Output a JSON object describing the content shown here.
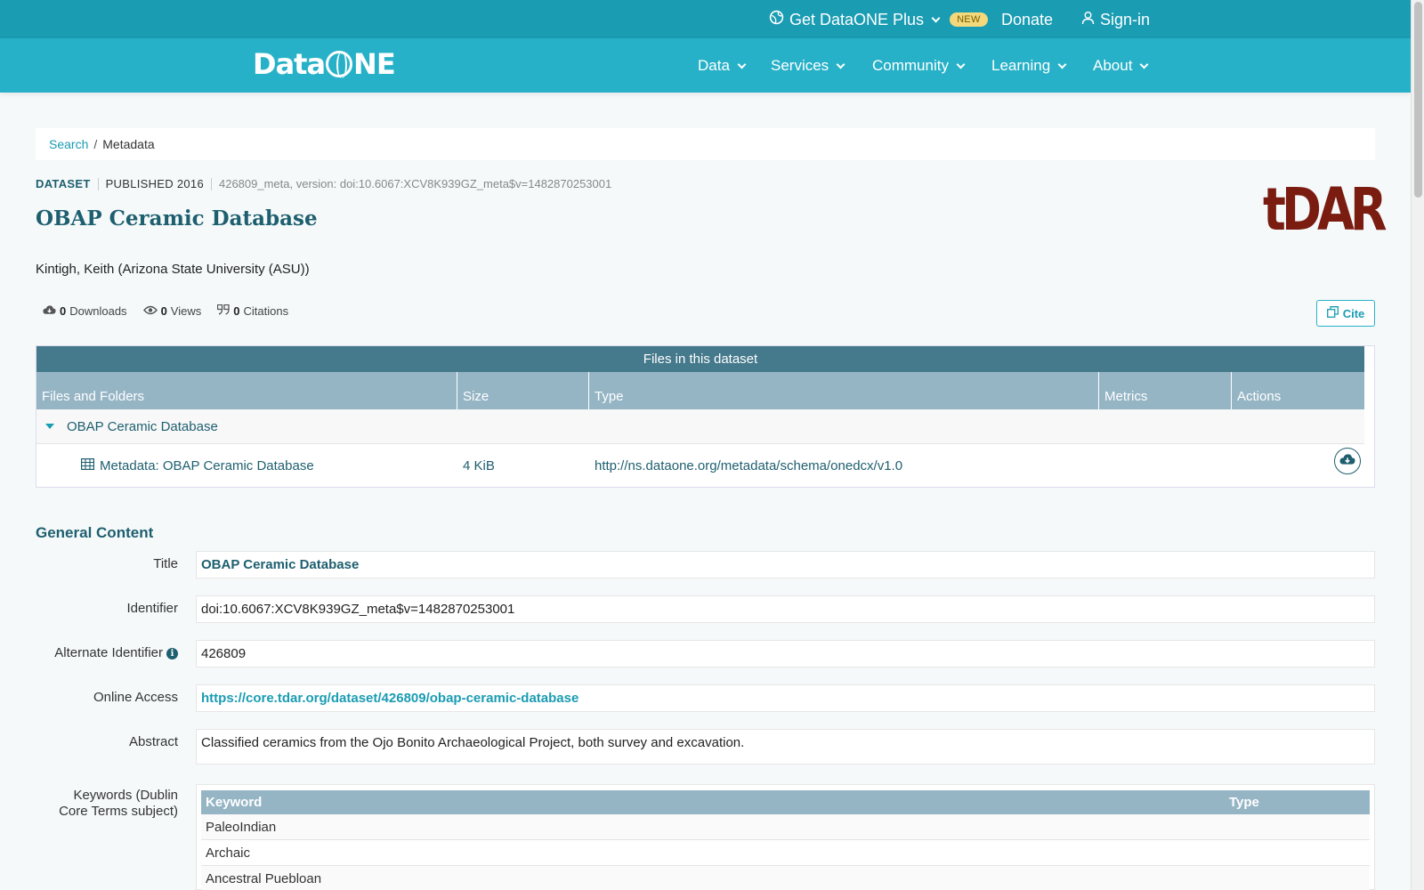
{
  "topbar": {
    "plus_label": "Get DataONE Plus",
    "new_badge": "NEW",
    "donate_label": "Donate",
    "signin_label": "Sign-in"
  },
  "logo": {
    "part1": "Data",
    "part2": "NE"
  },
  "nav": {
    "items": [
      {
        "label": "Data"
      },
      {
        "label": "Services"
      },
      {
        "label": "Community"
      },
      {
        "label": "Learning"
      },
      {
        "label": "About"
      }
    ]
  },
  "breadcrumb": {
    "search": "Search",
    "separator": "/",
    "current": "Metadata"
  },
  "dataset": {
    "type": "DATASET",
    "published": "PUBLISHED 2016",
    "version": "426809_meta, version: doi:10.6067:XCV8K939GZ_meta$v=1482870253001",
    "title": "OBAP Ceramic Database",
    "repo_logo": "tDAR",
    "author": "Kintigh, Keith (Arizona State University (ASU))"
  },
  "metrics": {
    "downloads_count": "0",
    "downloads_label": "Downloads",
    "views_count": "0",
    "views_label": "Views",
    "citations_count": "0",
    "citations_label": "Citations",
    "cite_label": "Cite"
  },
  "files": {
    "heading": "Files in this dataset",
    "columns": [
      "Files and Folders",
      "Size",
      "Type",
      "Metrics",
      "Actions"
    ],
    "folder": "OBAP Ceramic Database",
    "file": {
      "name": "Metadata: OBAP Ceramic Database",
      "size": "4 KiB",
      "type": "http://ns.dataone.org/metadata/schema/onedcx/v1.0"
    }
  },
  "general": {
    "heading": "General Content",
    "title_label": "Title",
    "title_value": "OBAP Ceramic Database",
    "identifier_label": "Identifier",
    "identifier_value": "doi:10.6067:XCV8K939GZ_meta$v=1482870253001",
    "alt_identifier_label": "Alternate Identifier",
    "alt_identifier_value": "426809",
    "online_label": "Online Access",
    "online_value": "https://core.tdar.org/dataset/426809/obap-ceramic-database",
    "abstract_label": "Abstract",
    "abstract_value": "Classified ceramics from the Ojo Bonito Archaeological Project, both survey and excavation.",
    "keywords_label_1": "Keywords (Dublin",
    "keywords_label_2": "Core Terms subject)",
    "keywords_columns": [
      "Keyword",
      "Type"
    ],
    "keywords": [
      "PaleoIndian",
      "Archaic",
      "Ancestral Puebloan"
    ]
  },
  "colors": {
    "topbar": "#1a9cb3",
    "nav": "#27b1c8",
    "table_header": "#45798c",
    "table_cols": "#95b5c5",
    "title": "#1e5f6f",
    "tdar": "#7a1c10"
  }
}
